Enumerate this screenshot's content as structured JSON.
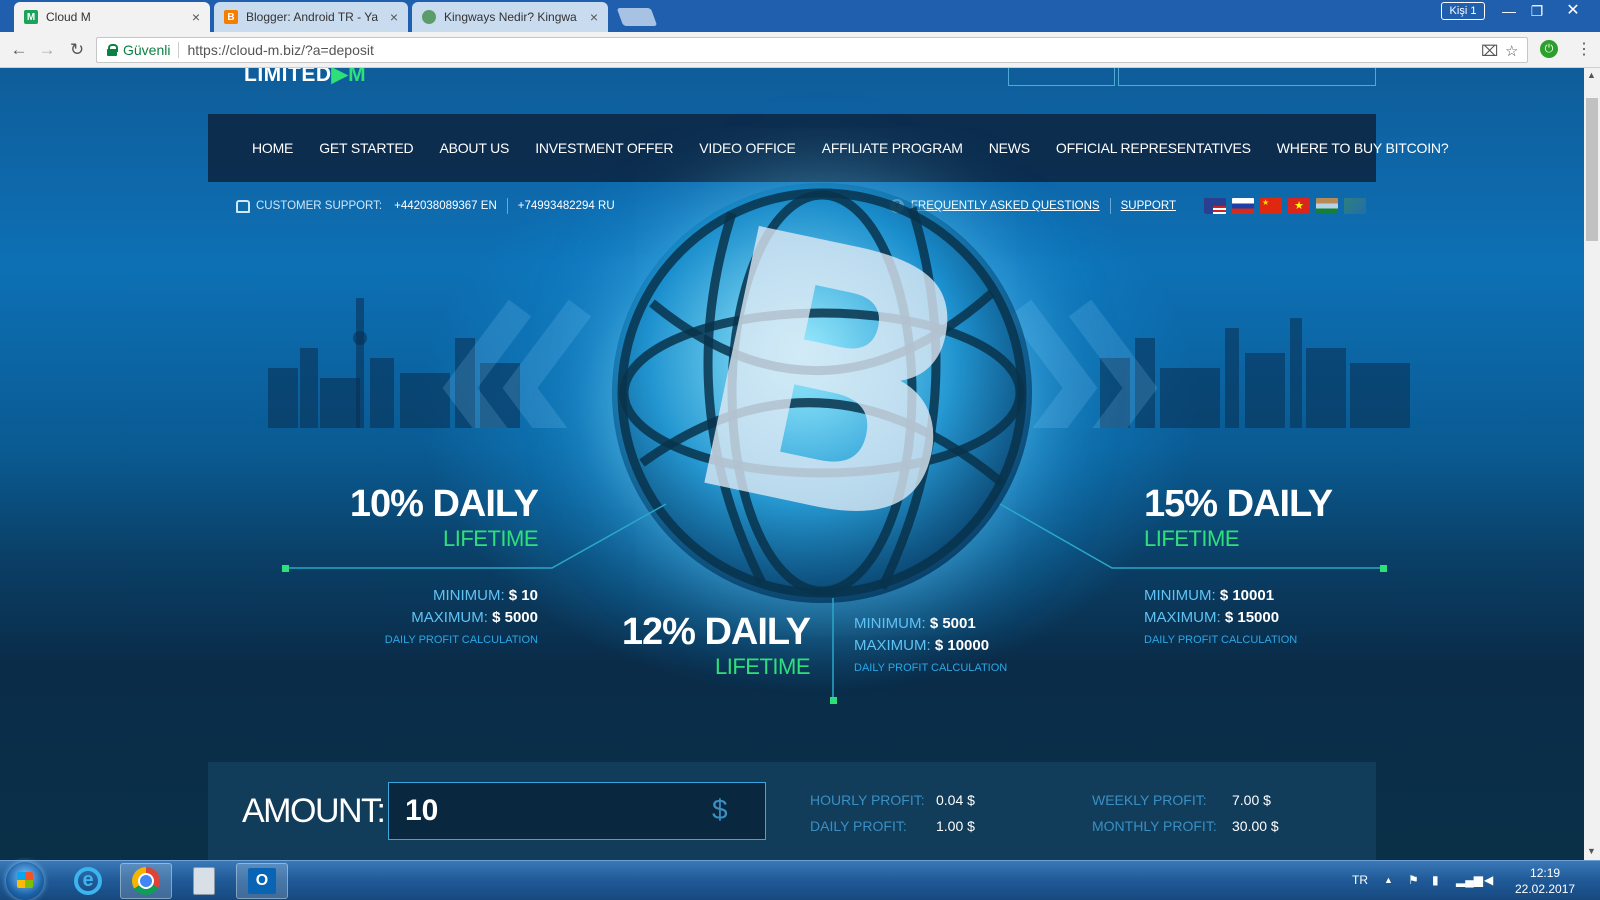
{
  "browser": {
    "tabs": [
      {
        "label": "Cloud M",
        "icon": "cloud-m-favicon",
        "active": true
      },
      {
        "label": "Blogger: Android TR - Ya",
        "icon": "blogger-favicon",
        "active": false
      },
      {
        "label": "Kingways Nedir? Kingwa",
        "icon": "kingways-favicon",
        "active": false
      }
    ],
    "profile_label": "Kişi 1",
    "secure_label": "Güvenli",
    "url": "https://cloud-m.biz/?a=deposit"
  },
  "site": {
    "logo_text": "LIMITED",
    "logo_accent": "▶M",
    "nav": [
      "HOME",
      "GET STARTED",
      "ABOUT US",
      "INVESTMENT OFFER",
      "VIDEO OFFICE",
      "AFFILIATE PROGRAM",
      "NEWS",
      "OFFICIAL REPRESENTATIVES",
      "WHERE TO BUY BITCOIN?"
    ],
    "support": {
      "label": "CUSTOMER SUPPORT:",
      "phone_en": "+442038089367 EN",
      "phone_ru": "+74993482294 RU",
      "faq": "FREQUENTLY ASKED QUESTIONS",
      "support_link": "SUPPORT"
    },
    "flags": [
      "us",
      "ru",
      "cn",
      "vn",
      "in",
      "other"
    ],
    "plans": [
      {
        "pct": "10% DAILY",
        "term": "LIFETIME",
        "min_label": "MINIMUM:",
        "min": "$ 10",
        "max_label": "MAXIMUM:",
        "max": "$ 5000",
        "calc": "DAILY PROFIT CALCULATION"
      },
      {
        "pct": "12% DAILY",
        "term": "LIFETIME",
        "min_label": "MINIMUM:",
        "min": "$ 5001",
        "max_label": "MAXIMUM:",
        "max": "$ 10000",
        "calc": "DAILY PROFIT CALCULATION"
      },
      {
        "pct": "15% DAILY",
        "term": "LIFETIME",
        "min_label": "MINIMUM:",
        "min": "$ 10001",
        "max_label": "MAXIMUM:",
        "max": "$ 15000",
        "calc": "DAILY PROFIT CALCULATION"
      }
    ],
    "calculator": {
      "amount_label": "AMOUNT:",
      "amount_value": "10",
      "currency": "$",
      "hourly_label": "HOURLY PROFIT:",
      "hourly": "0.04 $",
      "daily_label": "DAILY PROFIT:",
      "daily": "1.00 $",
      "weekly_label": "WEEKLY PROFIT:",
      "weekly": "7.00 $",
      "monthly_label": "MONTHLY PROFIT:",
      "monthly": "30.00 $"
    }
  },
  "taskbar": {
    "lang": "TR",
    "time": "12:19",
    "date": "22.02.2017"
  },
  "colors": {
    "accent_green": "#2ee07a",
    "accent_blue": "#5fc3f5",
    "nav_bg": "#0c2642"
  }
}
